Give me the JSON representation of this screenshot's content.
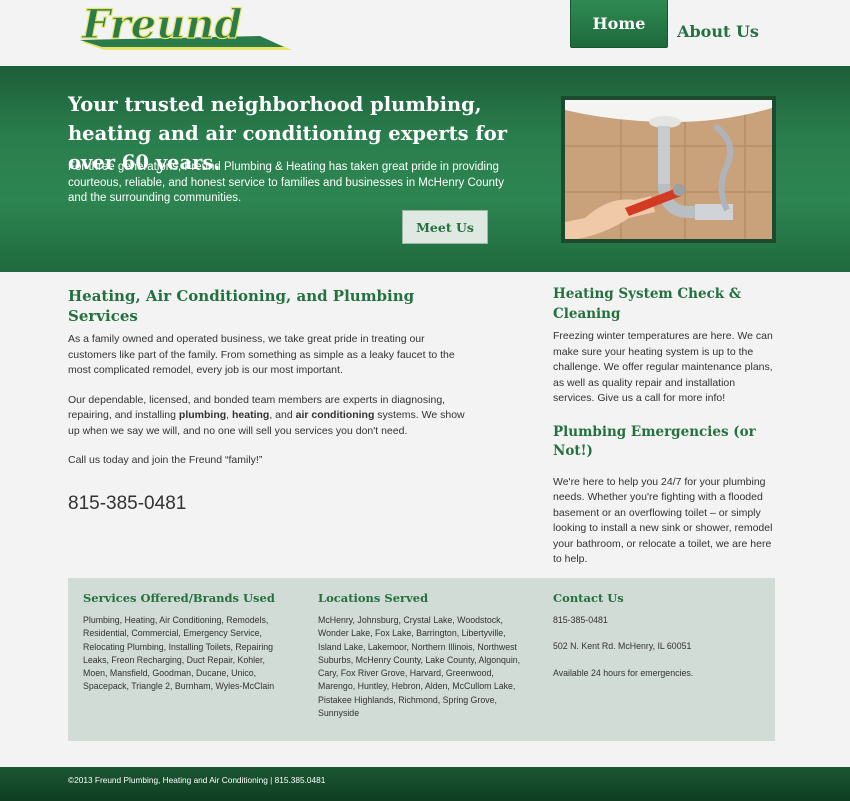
{
  "brand": {
    "logo_text": "Freund"
  },
  "nav": {
    "home": "Home",
    "about": "About Us"
  },
  "hero": {
    "title": "Your trusted neighborhood plumbing, heating and air conditioning experts for over 60 years.",
    "text": "For three generations, Freund Plumbing & Heating has taken great pride in providing courteous, reliable, and honest service to families and businesses in McHenry County and the surrounding communities.",
    "button": "Meet Us"
  },
  "main": {
    "title": "Heating, Air Conditioning, and Plumbing Services",
    "p1": "As a family owned and operated business, we take great pride in treating our customers like part of the family. From something as simple as a leaky faucet to the most complicated remodel, every job is our most important.",
    "p2_a": "Our dependable, licensed, and bonded team members are experts in diagnosing, repairing, and installing ",
    "p2_b1": "plumbing",
    "p2_sep1": ", ",
    "p2_b2": "heating",
    "p2_sep2": ", and ",
    "p2_b3": "air conditioning",
    "p2_c": " systems. We show up when we say we will, and no one will sell you services you don't need.",
    "p3": "Call us today and join the Freund “family!”",
    "phone": "815-385-0481"
  },
  "sidebar": {
    "h1": "Heating System Check & Cleaning",
    "p1": "Freezing winter temperatures are here. We can make sure your heating system is up to the challenge. We offer regular maintenance plans, as well as quality repair and installation services. Give us a call for more info!",
    "h2": "Plumbing Emergencies (or Not!)",
    "p2": "We're here to help you 24/7 for your plumbing needs. Whether you're fighting with a flooded basement or an overflowing toilet – or simply looking to install a new sink or shower, remodel your bathroom, or relocate a toilet, we are here to help."
  },
  "footer": {
    "services_title": "Services Offered/Brands Used",
    "services_text": "Plumbing, Heating, Air Conditioning, Remodels, Residential, Commercial, Emergency Service, Relocating Plumbing, Installing Toilets, Repairing Leaks, Freon Recharging, Duct Repair, Kohler, Moen, Mansfield, Goodman, Ducane, Unico, Spacepack, Triangle 2, Burnham, Wyles-McClain",
    "locations_title": "Locations Served",
    "locations_text": "McHenry, Johnsburg, Crystal Lake, Woodstock, Wonder Lake, Fox Lake, Barrington, Libertyville, Island Lake, Lakemoor, Northern Illinois, Northwest Suburbs, McHenry County, Lake County, Algonquin, Cary, Fox River Grove, Harvard, Greenwood, Marengo, Huntley, Hebron, Alden, McCullom Lake, Pistakee Highlands, Richmond, Spring Grove, Sunnyside",
    "contact_title": "Contact Us",
    "contact_phone": "815-385-0481",
    "contact_address": "502 N. Kent Rd. McHenry, IL 60051",
    "contact_hours": "Available 24 hours for emergencies.",
    "copyright": "©2013 Freund Plumbing, Heating and Air Conditioning | 815.385.0481"
  },
  "colors": {
    "brand_green": "#24703f",
    "hero_green": "#2a7e4d",
    "footer_box": "#d0dcd5",
    "logo_yellow": "#e9e36a"
  },
  "icons": {
    "hero_photo": "sink-plumbing-photo"
  }
}
